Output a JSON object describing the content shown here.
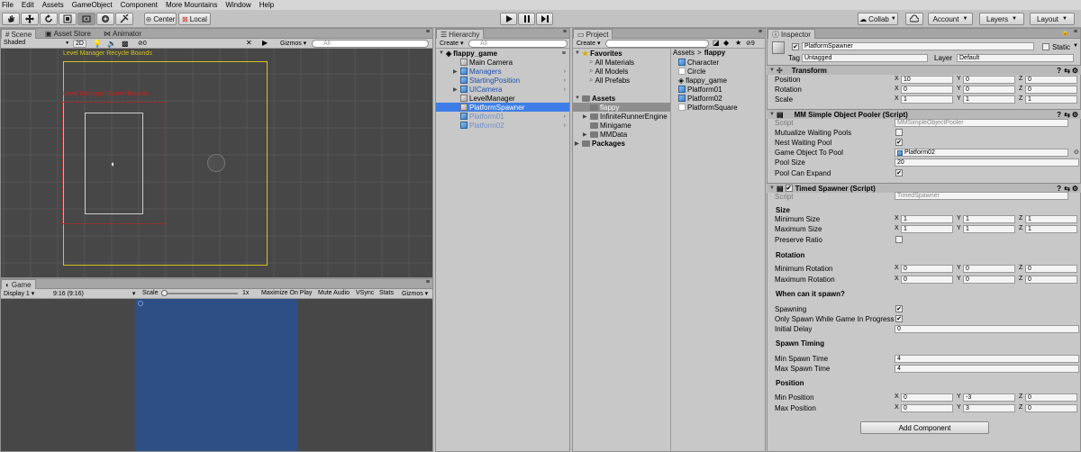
{
  "menu": [
    "File",
    "Edit",
    "Assets",
    "GameObject",
    "Component",
    "More Mountains",
    "Window",
    "Help"
  ],
  "toolbar": {
    "pivot": "Center",
    "space": "Local",
    "collab": "Collab",
    "account": "Account",
    "layers": "Layers",
    "layout": "Layout"
  },
  "scene": {
    "tabs": [
      "Scene",
      "Asset Store",
      "Animator"
    ],
    "shading": "Shaded",
    "mode2d": "2D",
    "effects_count": "0",
    "gizmos": "Gizmos",
    "search_placeholder": "All",
    "bounds_label": "Level Manager Recycle Bounds",
    "spawn_label": "Level Manager Spawn Bounds"
  },
  "game": {
    "tab": "Game",
    "display": "Display 1",
    "aspect": "9:16 (9:16)",
    "scale_label": "Scale",
    "scale_value": "1x",
    "maximize": "Maximize On Play",
    "mute": "Mute Audio",
    "vsync": "VSync",
    "stats": "Stats",
    "gizmos": "Gizmos"
  },
  "hierarchy": {
    "tab": "Hierarchy",
    "create": "Create",
    "search_placeholder": "All",
    "scene_name": "flappy_game",
    "items": [
      {
        "label": "Main Camera",
        "prefab": false,
        "expandable": false,
        "selected": false,
        "color": "#000000"
      },
      {
        "label": "Managers",
        "prefab": true,
        "expandable": true,
        "selected": false,
        "color": "#1f4fae"
      },
      {
        "label": "StartingPosition",
        "prefab": true,
        "expandable": false,
        "selected": false,
        "color": "#1f4fae"
      },
      {
        "label": "UICamera",
        "prefab": true,
        "expandable": true,
        "selected": false,
        "color": "#1f4fae"
      },
      {
        "label": "LevelManager",
        "prefab": false,
        "expandable": false,
        "selected": false,
        "color": "#000000"
      },
      {
        "label": "PlatformSpawner",
        "prefab": false,
        "expandable": false,
        "selected": true,
        "color": "#ffffff"
      },
      {
        "label": "Platform01",
        "prefab": true,
        "expandable": false,
        "selected": false,
        "color": "#6f8fc8"
      },
      {
        "label": "Platform02",
        "prefab": true,
        "expandable": false,
        "selected": false,
        "color": "#6f8fc8"
      }
    ]
  },
  "project": {
    "tab": "Project",
    "create": "Create",
    "breadcrumb_root": "Assets",
    "breadcrumb_sep": ">",
    "breadcrumb_folder": "flappy",
    "count": "9",
    "favorites_label": "Favorites",
    "favorites": [
      "All Materials",
      "All Models",
      "All Prefabs"
    ],
    "assets_label": "Assets",
    "folders": [
      {
        "label": "flappy",
        "selected": true,
        "expandable": false
      },
      {
        "label": "InfiniteRunnerEngine",
        "selected": false,
        "expandable": true
      },
      {
        "label": "Minigame",
        "selected": false,
        "expandable": false
      },
      {
        "label": "MMData",
        "selected": false,
        "expandable": true
      }
    ],
    "packages_label": "Packages",
    "files": [
      {
        "label": "Character",
        "icon": "prefab-icon"
      },
      {
        "label": "Circle",
        "icon": "sprite-icon"
      },
      {
        "label": "flappy_game",
        "icon": "unity-scene-icon"
      },
      {
        "label": "Platform01",
        "icon": "prefab-icon"
      },
      {
        "label": "Platform02",
        "icon": "prefab-icon"
      },
      {
        "label": "PlatformSquare",
        "icon": "sprite-icon"
      }
    ]
  },
  "inspector": {
    "tab": "Inspector",
    "object_name": "PlatformSpawner",
    "static_label": "Static",
    "tag_label": "Tag",
    "tag_value": "Untagged",
    "layer_label": "Layer",
    "layer_value": "Default",
    "transform": {
      "title": "Transform",
      "rows": [
        {
          "label": "Position",
          "x": "10",
          "y": "0",
          "z": "0"
        },
        {
          "label": "Rotation",
          "x": "0",
          "y": "0",
          "z": "0"
        },
        {
          "label": "Scale",
          "x": "1",
          "y": "1",
          "z": "1"
        }
      ]
    },
    "pooler": {
      "title": "MM Simple Object Pooler (Script)",
      "script_label": "Script",
      "script_value": "MMSimpleObjectPooler",
      "mutualize_label": "Mutualize Waiting Pools",
      "mutualize": false,
      "nest_label": "Nest Waiting Pool",
      "nest": true,
      "game_object_label": "Game Object To Pool",
      "game_object_value": "Platform02",
      "pool_size_label": "Pool Size",
      "pool_size": "20",
      "expand_label": "Pool Can Expand",
      "expand": true
    },
    "spawner": {
      "title": "Timed Spawner (Script)",
      "script_label": "Script",
      "script_value": "TimedSpawner",
      "size_header": "Size",
      "min_size_label": "Minimum Size",
      "min_size": {
        "x": "1",
        "y": "1",
        "z": "1"
      },
      "max_size_label": "Maximum Size",
      "max_size": {
        "x": "1",
        "y": "1",
        "z": "1"
      },
      "preserve_label": "Preserve Ratio",
      "preserve": false,
      "rotation_header": "Rotation",
      "min_rot_label": "Minimum Rotation",
      "min_rot": {
        "x": "0",
        "y": "0",
        "z": "0"
      },
      "max_rot_label": "Maximum Rotation",
      "max_rot": {
        "x": "0",
        "y": "0",
        "z": "0"
      },
      "when_header": "When can it spawn?",
      "spawning_label": "Spawning",
      "spawning": true,
      "only_spawn_label": "Only Spawn While Game In Progress",
      "only_spawn": true,
      "initial_delay_label": "Initial Delay",
      "initial_delay": "0",
      "timing_header": "Spawn Timing",
      "min_time_label": "Min Spawn Time",
      "min_time": "4",
      "max_time_label": "Max Spawn Time",
      "max_time": "4",
      "position_header": "Position",
      "min_pos_label": "Min Position",
      "min_pos": {
        "x": "0",
        "y": "-3",
        "z": "0"
      },
      "max_pos_label": "Max Position",
      "max_pos": {
        "x": "0",
        "y": "3",
        "z": "0"
      }
    },
    "add_component": "Add Component"
  },
  "colors": {
    "selection": "#3e7de7",
    "game_bg": "#2e4f86",
    "scene_bg": "#474747",
    "recycle_bounds": "#d6c420",
    "spawn_bounds": "#c42020"
  }
}
